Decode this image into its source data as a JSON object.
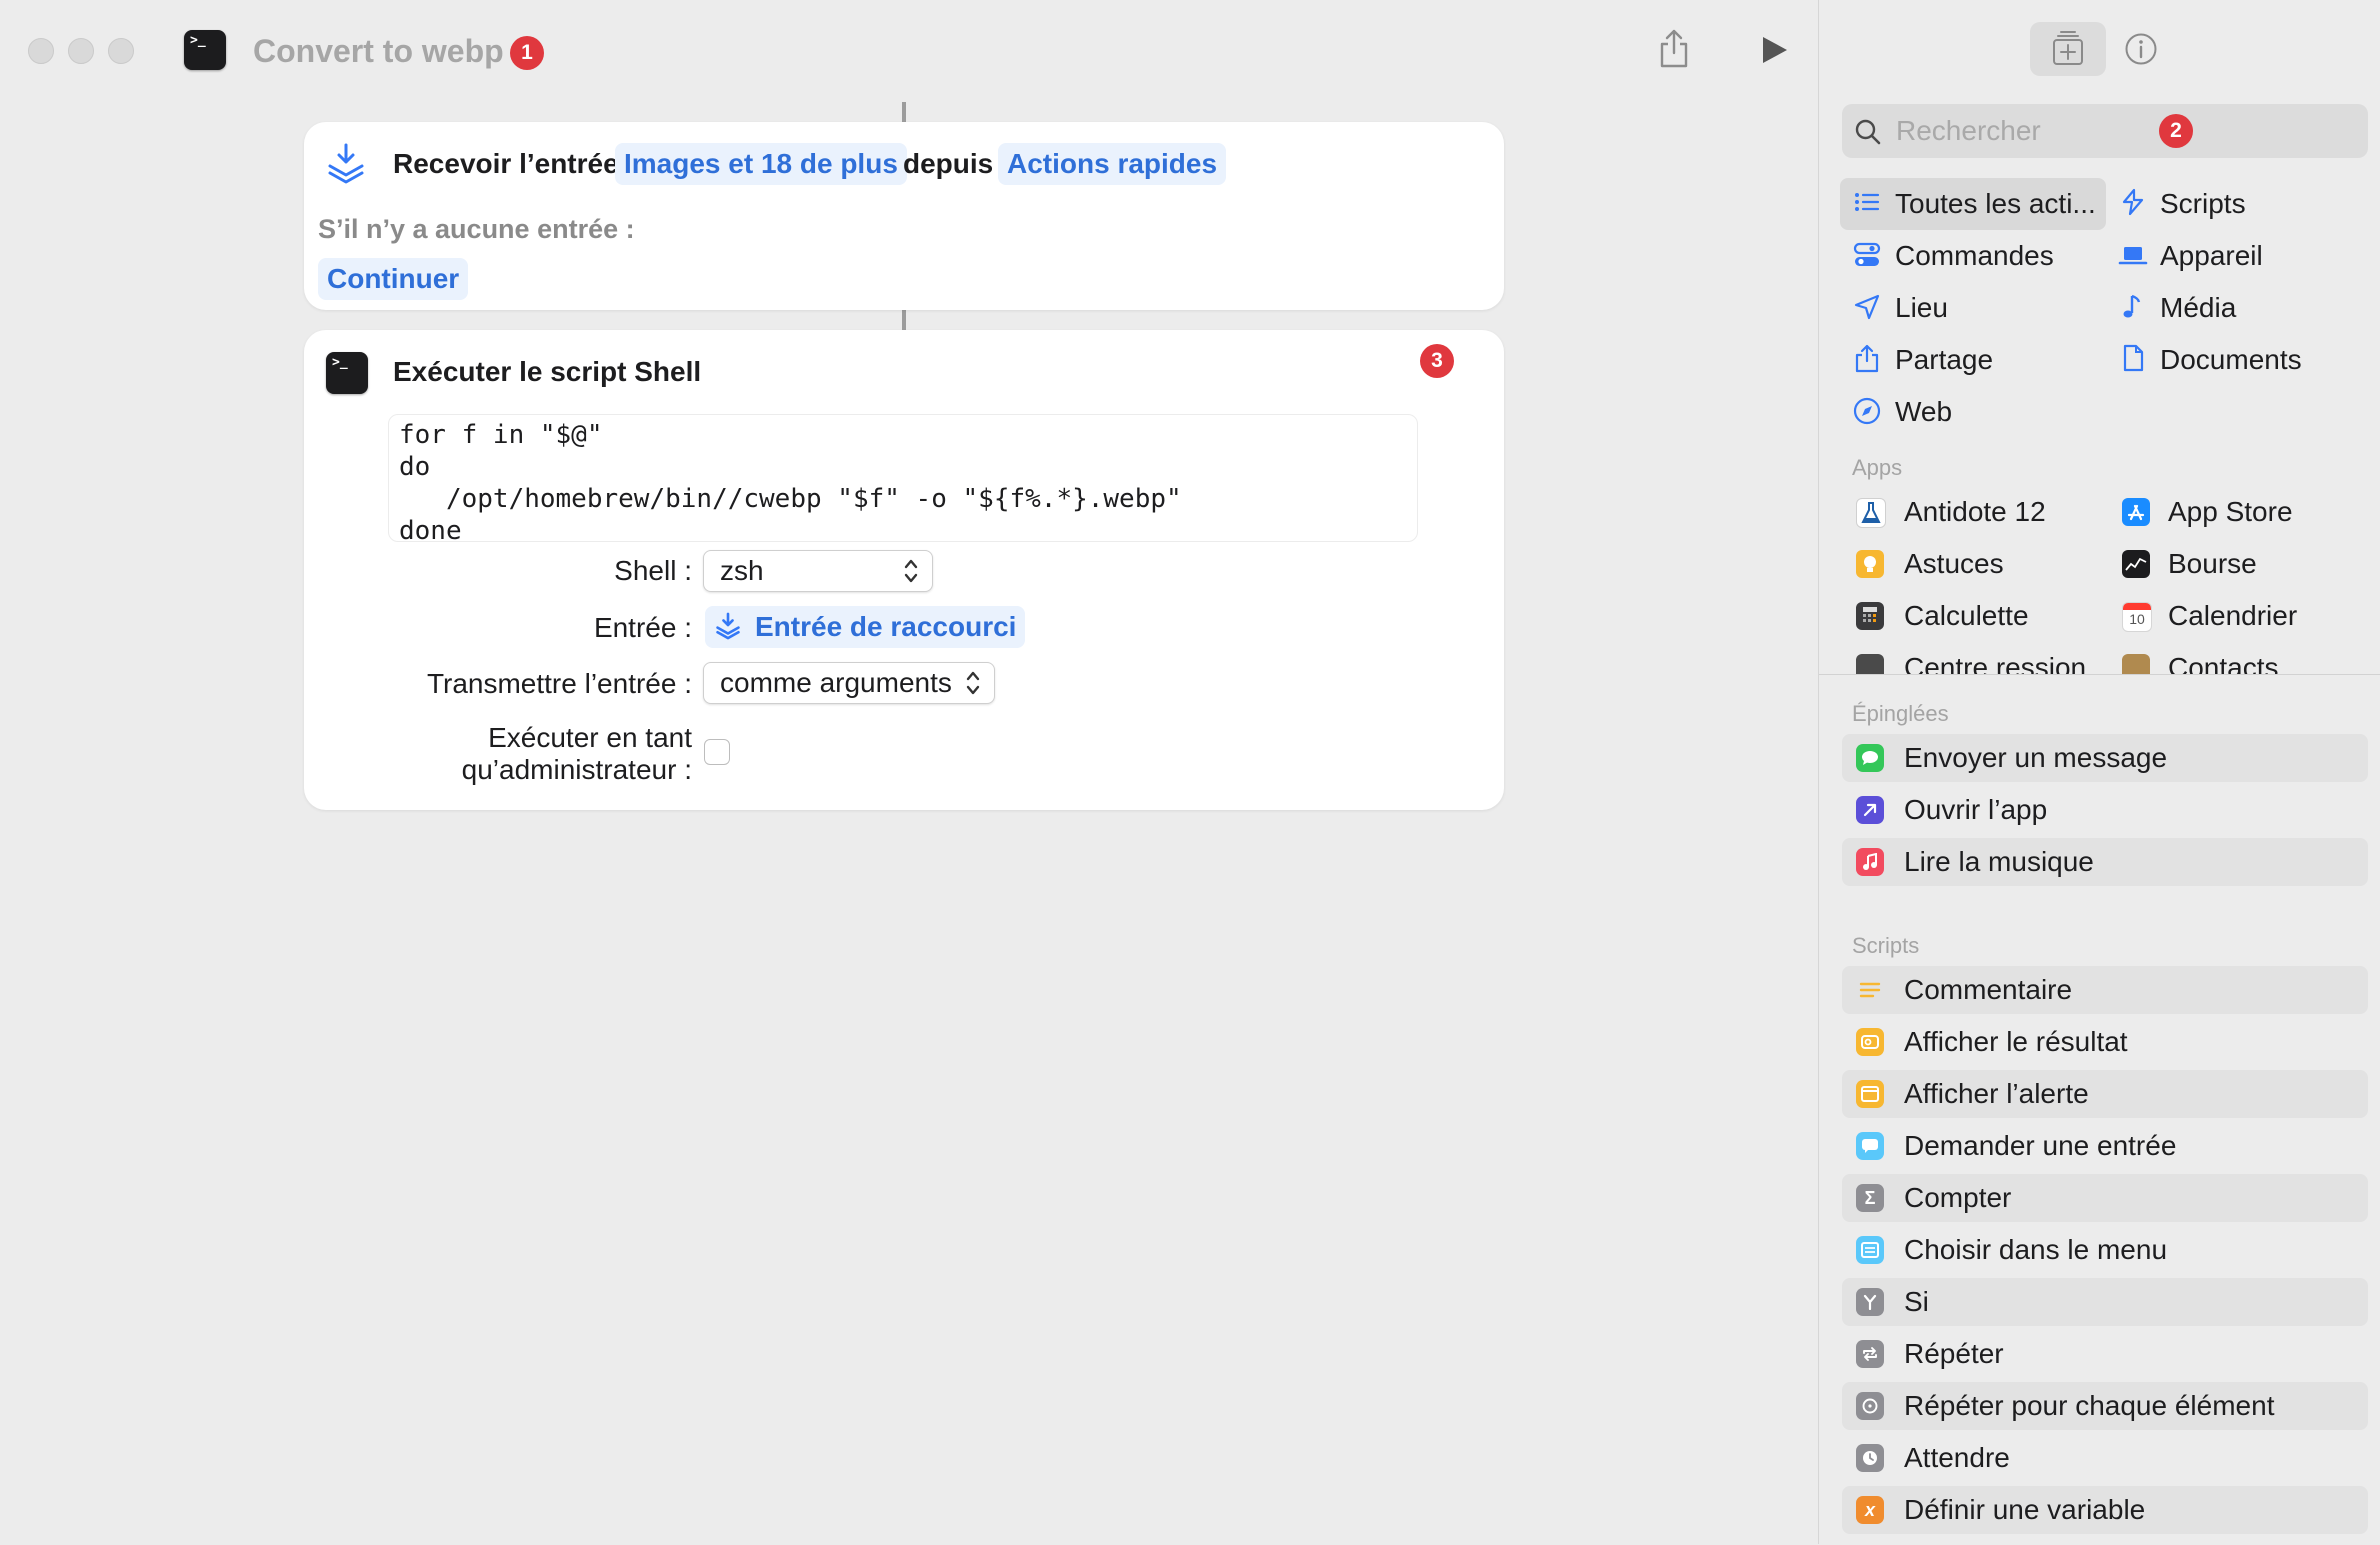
{
  "window": {
    "title": "Convert to webp",
    "title_badge": "1"
  },
  "editor": {
    "receive_action": {
      "label": "Recevoir l’entrée",
      "types_token": "Images et 18 de plus",
      "from_label": "depuis",
      "source_token": "Actions rapides",
      "no_input_label": "S’il n’y a aucune entrée :",
      "no_input_token": "Continuer"
    },
    "shell_action": {
      "title": "Exécuter le script Shell",
      "badge": "3",
      "script": "for f in \"$@\"\ndo\n   /opt/homebrew/bin//cwebp \"$f\" -o \"${f%.*}.webp\"\ndone",
      "shell_label": "Shell :",
      "shell_value": "zsh",
      "input_label": "Entrée :",
      "input_token": "Entrée de raccourci",
      "pass_input_label": "Transmettre l’entrée :",
      "pass_input_value": "comme arguments",
      "run_as_admin_label_1": "Exécuter en tant",
      "run_as_admin_label_2": "qu’administrateur :",
      "run_as_admin_checked": false
    }
  },
  "sidebar": {
    "search_placeholder": "Rechercher",
    "search_badge": "2",
    "categories_left": [
      "Toutes les acti...",
      "Commandes",
      "Lieu",
      "Partage",
      "Web"
    ],
    "categories_right": [
      "Scripts",
      "Appareil",
      "Média",
      "Documents"
    ],
    "apps_title": "Apps",
    "apps_left": [
      "Antidote 12",
      "Astuces",
      "Calculette",
      "Centre   ression"
    ],
    "apps_right": [
      "App Store",
      "Bourse",
      "Calendrier",
      "Contacts"
    ],
    "calendar_day": "10",
    "pinned_title": "Épinglées",
    "pinned": [
      "Envoyer un message",
      "Ouvrir l’app",
      "Lire la musique"
    ],
    "scripts_title": "Scripts",
    "scripts": [
      "Commentaire",
      "Afficher le résultat",
      "Afficher l’alerte",
      "Demander une entrée",
      "Compter",
      "Choisir dans le menu",
      "Si",
      "Répéter",
      "Répéter pour chaque élément",
      "Attendre",
      "Définir une variable"
    ],
    "colors": {
      "accent": "#3478f6",
      "badge": "#e0383e",
      "messages": "#34c759",
      "open_app": "#5b4fd8",
      "music": "#f24b5f",
      "scripting_gray": "#8e8e93",
      "yellow": "#f7b731",
      "light_blue": "#5ac8fa",
      "orange": "#f08c2e"
    }
  }
}
